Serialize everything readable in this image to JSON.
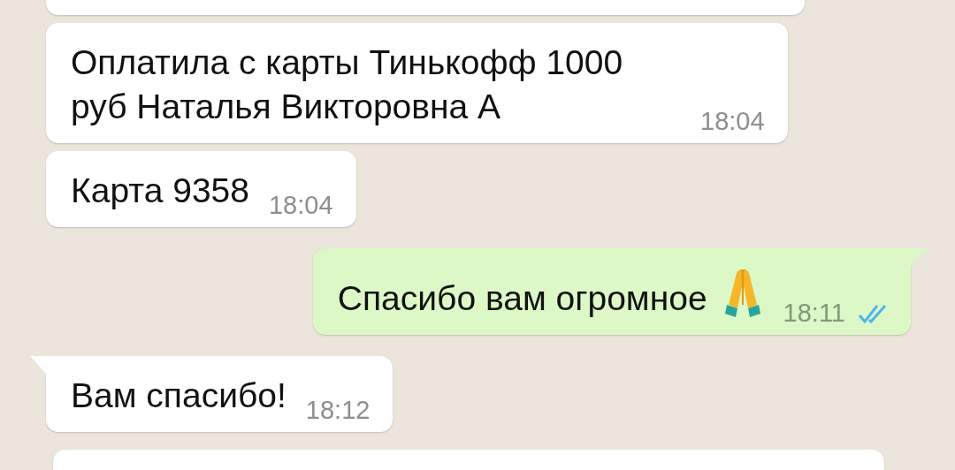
{
  "messages": [
    {
      "kind": "partial"
    },
    {
      "kind": "text",
      "outgoing": false,
      "tail": false,
      "text": "Оплатила с карты Тинькофф 1000 руб Наталья Викторовна А",
      "time": "18:04"
    },
    {
      "kind": "text",
      "outgoing": false,
      "tail": false,
      "text": "Карта 9358",
      "time": "18:04"
    },
    {
      "kind": "text",
      "outgoing": true,
      "tail": true,
      "text": "Спасибо вам огромное",
      "emoji": true,
      "time": "18:11",
      "read": true
    },
    {
      "kind": "text",
      "outgoing": false,
      "tail": true,
      "text": "Вам спасибо!",
      "time": "18:12"
    },
    {
      "kind": "partial"
    }
  ]
}
